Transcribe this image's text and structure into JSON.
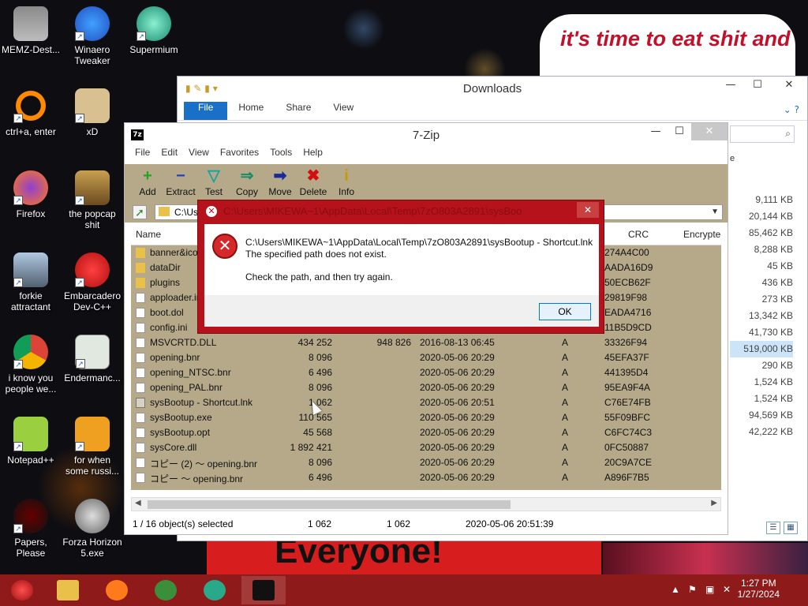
{
  "desktop": {
    "banner_top": "it's time to eat shit and die andcelebrate",
    "banner_bottom": "Everyone!",
    "icons": [
      {
        "label": "MEMZ-Dest..."
      },
      {
        "label": "Winaero Tweaker"
      },
      {
        "label": "Supermium"
      },
      {
        "label": "ctrl+a, enter"
      },
      {
        "label": "xD"
      },
      {
        "label": "Firefox"
      },
      {
        "label": "the popcap shit"
      },
      {
        "label": "forkie attractant"
      },
      {
        "label": "Embarcadero Dev-C++"
      },
      {
        "label": "i know you people we..."
      },
      {
        "label": "Endermanc..."
      },
      {
        "label": "Notepad++"
      },
      {
        "label": "for when some russi..."
      },
      {
        "label": "Papers, Please"
      },
      {
        "label": "Forza Horizon 5.exe"
      }
    ]
  },
  "explorer": {
    "title": "Downloads",
    "tabs": [
      "File",
      "Home",
      "Share",
      "View"
    ],
    "column_partial": "e",
    "sizes": [
      "9,111 KB",
      "20,144 KB",
      "85,462 KB",
      "8,288 KB",
      "45 KB",
      "436 KB",
      "273 KB",
      "13,342 KB",
      "41,730 KB",
      "519,000 KB",
      "290 KB",
      "1,524 KB",
      "1,524 KB",
      "94,569 KB",
      "42,222 KB"
    ]
  },
  "sevenzip": {
    "title": "7-Zip",
    "app_icon": "7z",
    "menu": [
      "File",
      "Edit",
      "View",
      "Favorites",
      "Tools",
      "Help"
    ],
    "toolbar": [
      {
        "label": "Add",
        "glyph": "+",
        "color": "#1fa81f"
      },
      {
        "label": "Extract",
        "glyph": "−",
        "color": "#1a3fc9"
      },
      {
        "label": "Test",
        "glyph": "▽",
        "color": "#1aa0a0"
      },
      {
        "label": "Copy",
        "glyph": "⇒",
        "color": "#1a8a6a"
      },
      {
        "label": "Move",
        "glyph": "➡",
        "color": "#1a2a9a"
      },
      {
        "label": "Delete",
        "glyph": "✖",
        "color": "#d01010"
      },
      {
        "label": "Info",
        "glyph": "i",
        "color": "#c89a00"
      }
    ],
    "address": "C:\\Us",
    "columns": {
      "name": "Name",
      "crc": "CRC",
      "encrypted": "Encrypte"
    },
    "files": [
      {
        "type": "folder",
        "name": "banner&ico",
        "size": "",
        "packed": "",
        "modified": "",
        "attr": "",
        "crc": "274A4C00"
      },
      {
        "type": "folder",
        "name": "dataDir",
        "size": "",
        "packed": "",
        "modified": "",
        "attr": "",
        "crc": "AADA16D9"
      },
      {
        "type": "folder",
        "name": "plugins",
        "size": "",
        "packed": "",
        "modified": "",
        "attr": "",
        "crc": "50ECB62F"
      },
      {
        "type": "file",
        "name": "apploader.in",
        "size": "",
        "packed": "",
        "modified": "",
        "attr": "",
        "crc": "29819F98"
      },
      {
        "type": "file",
        "name": "boot.dol",
        "size": "",
        "packed": "",
        "modified": "",
        "attr": "",
        "crc": "EADA4716"
      },
      {
        "type": "file",
        "name": "config.ini",
        "size": "",
        "packed": "",
        "modified": "",
        "attr": "",
        "crc": "11B5D9CD"
      },
      {
        "type": "file",
        "name": "MSVCRTD.DLL",
        "size": "434 252",
        "packed": "948 826",
        "modified": "2016-08-13 06:45",
        "attr": "A",
        "crc": "33326F94"
      },
      {
        "type": "file",
        "name": "opening.bnr",
        "size": "8 096",
        "packed": "",
        "modified": "2020-05-06 20:29",
        "attr": "A",
        "crc": "45EFA37F"
      },
      {
        "type": "file",
        "name": "opening_NTSC.bnr",
        "size": "6 496",
        "packed": "",
        "modified": "2020-05-06 20:29",
        "attr": "A",
        "crc": "441395D4"
      },
      {
        "type": "file",
        "name": "opening_PAL.bnr",
        "size": "8 096",
        "packed": "",
        "modified": "2020-05-06 20:29",
        "attr": "A",
        "crc": "95EA9F4A"
      },
      {
        "type": "lnk",
        "name": "sysBootup - Shortcut.lnk",
        "size": "1 062",
        "packed": "",
        "modified": "2020-05-06 20:51",
        "attr": "A",
        "crc": "C76E74FB"
      },
      {
        "type": "file",
        "name": "sysBootup.exe",
        "size": "110 565",
        "packed": "",
        "modified": "2020-05-06 20:29",
        "attr": "A",
        "crc": "55F09BFC"
      },
      {
        "type": "file",
        "name": "sysBootup.opt",
        "size": "45 568",
        "packed": "",
        "modified": "2020-05-06 20:29",
        "attr": "A",
        "crc": "C6FC74C3"
      },
      {
        "type": "file",
        "name": "sysCore.dll",
        "size": "1 892 421",
        "packed": "",
        "modified": "2020-05-06 20:29",
        "attr": "A",
        "crc": "0FC50887"
      },
      {
        "type": "file",
        "name": "コピー (2) ～ opening.bnr",
        "size": "8 096",
        "packed": "",
        "modified": "2020-05-06 20:29",
        "attr": "A",
        "crc": "20C9A7CE"
      },
      {
        "type": "file",
        "name": "コピー ～ opening.bnr",
        "size": "6 496",
        "packed": "",
        "modified": "2020-05-06 20:29",
        "attr": "A",
        "crc": "A896F7B5"
      }
    ],
    "status": {
      "selection": "1 / 16 object(s) selected",
      "size": "1 062",
      "packed": "1 062",
      "modified": "2020-05-06 20:51:39"
    }
  },
  "error_dialog": {
    "title": "C:\\Users\\MIKEWA~1\\AppData\\Local\\Temp\\7zO803A2891\\sysBoo",
    "path": "C:\\Users\\MIKEWA~1\\AppData\\Local\\Temp\\7zO803A2891\\sysBootup - Shortcut.lnk",
    "line1": "The specified path does not exist.",
    "line2": "Check the path, and then try again.",
    "ok": "OK"
  },
  "taskbar": {
    "time": "1:27 PM",
    "date": "1/27/2024",
    "apps": [
      {
        "name": "file-explorer",
        "color": "#e8c04a"
      },
      {
        "name": "firefox",
        "color": "#ff7a1a"
      },
      {
        "name": "chrome",
        "color": "#3b8f3b"
      },
      {
        "name": "supermium",
        "color": "#2aa88a"
      },
      {
        "name": "7zip",
        "color": "#111111"
      }
    ]
  }
}
